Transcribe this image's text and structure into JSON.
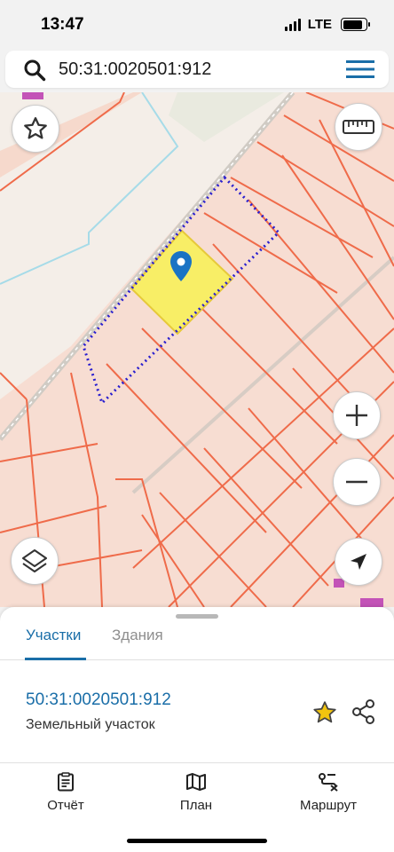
{
  "status_bar": {
    "time": "13:47",
    "network": "LTE",
    "battery_level": 0.85
  },
  "search": {
    "value": "50:31:0020501:912",
    "search_icon": "search-icon",
    "menu_icon": "hamburger-menu-icon"
  },
  "map": {
    "controls": [
      "favorite-star-icon",
      "ruler-icon",
      "zoom-in-icon",
      "zoom-out-icon",
      "layers-icon",
      "navigation-arrow-icon"
    ],
    "pin_icon": "location-pin-icon",
    "colors": {
      "background": "#f7ddd2",
      "parcel_border": "#ef6b4a",
      "selected_parcel": "#f8ee66",
      "outline_dotted": "#2a1fcf",
      "pin": "#1a73c4"
    }
  },
  "tabs": [
    {
      "label": "Участки",
      "active": true
    },
    {
      "label": "Здания",
      "active": false
    }
  ],
  "parcel": {
    "number": "50:31:0020501:912",
    "type": "Земельный участок",
    "favorite_icon": "star-icon",
    "share_icon": "share-icon"
  },
  "bottom_nav": [
    {
      "label": "Отчёт",
      "icon": "report-icon"
    },
    {
      "label": "План",
      "icon": "map-plan-icon"
    },
    {
      "label": "Маршрут",
      "icon": "route-icon"
    }
  ],
  "colors": {
    "accent": "#1a6ea8",
    "star_fill": "#f1c40f"
  }
}
